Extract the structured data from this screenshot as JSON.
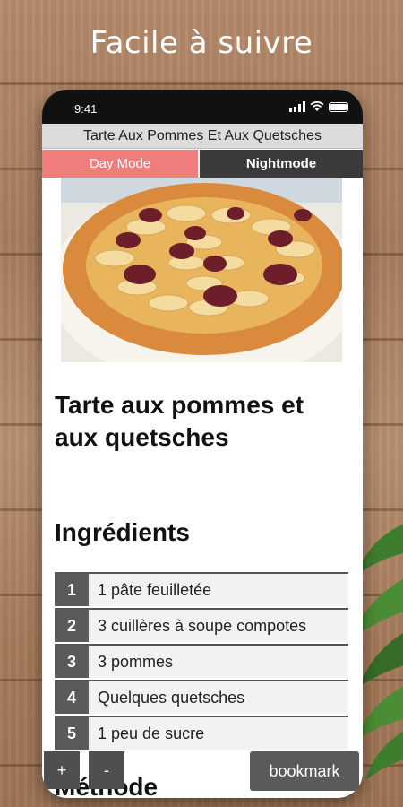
{
  "promo": {
    "headline": "Facile à suivre"
  },
  "status_bar": {
    "time": "9:41"
  },
  "app": {
    "title": "Tarte Aux Pommes Et Aux Quetsches",
    "tabs": {
      "day_mode": "Day Mode",
      "night_mode": "Nightmode"
    },
    "accent_color": "#f07c7c"
  },
  "recipe": {
    "title": "Tarte aux pommes et aux quetsches",
    "ingredients_heading": "Ingrédients",
    "ingredients": [
      {
        "num": "1",
        "text": "1 pâte feuilletée"
      },
      {
        "num": "2",
        "text": "3 cuillères à soupe compotes"
      },
      {
        "num": "3",
        "text": "3 pommes"
      },
      {
        "num": "4",
        "text": "Quelques quetsches"
      },
      {
        "num": "5",
        "text": "1 peu de sucre"
      }
    ],
    "method_heading": "Méthode"
  },
  "controls": {
    "plus": "+",
    "minus": "-",
    "bookmark": "bookmark"
  }
}
